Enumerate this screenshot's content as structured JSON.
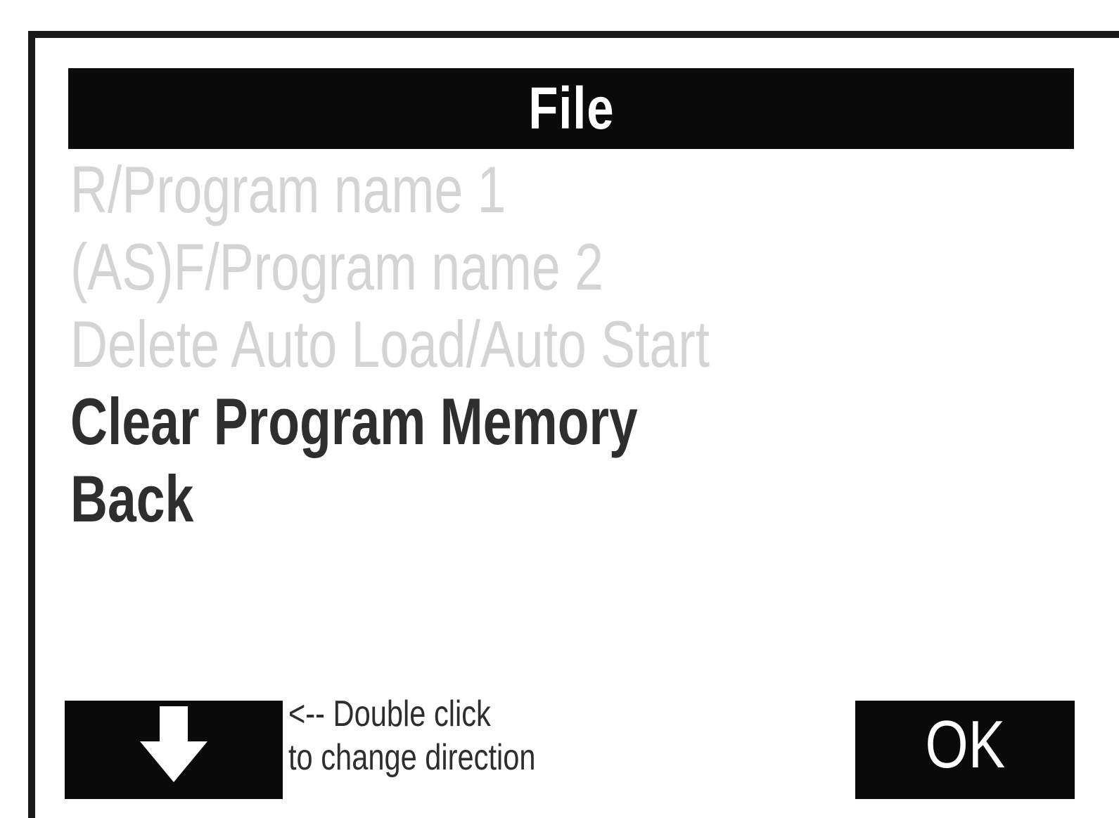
{
  "title": "File",
  "menu": {
    "items": [
      {
        "label": "R/Program name 1",
        "enabled": false
      },
      {
        "label": "(AS)F/Program name 2",
        "enabled": false
      },
      {
        "label": "Delete Auto Load/Auto Start",
        "enabled": false
      },
      {
        "label": "Clear Program Memory",
        "enabled": true
      },
      {
        "label": "Back",
        "enabled": true
      }
    ]
  },
  "footer": {
    "direction_icon": "arrow-down-icon",
    "hint_line1": "<-- Double click",
    "hint_line2": "to change direction",
    "ok_label": "OK"
  },
  "colors": {
    "bar_background": "#0a0a0a",
    "bar_text": "#ffffff",
    "enabled_text": "#2e2e2e",
    "disabled_text": "#d4d4d4"
  }
}
